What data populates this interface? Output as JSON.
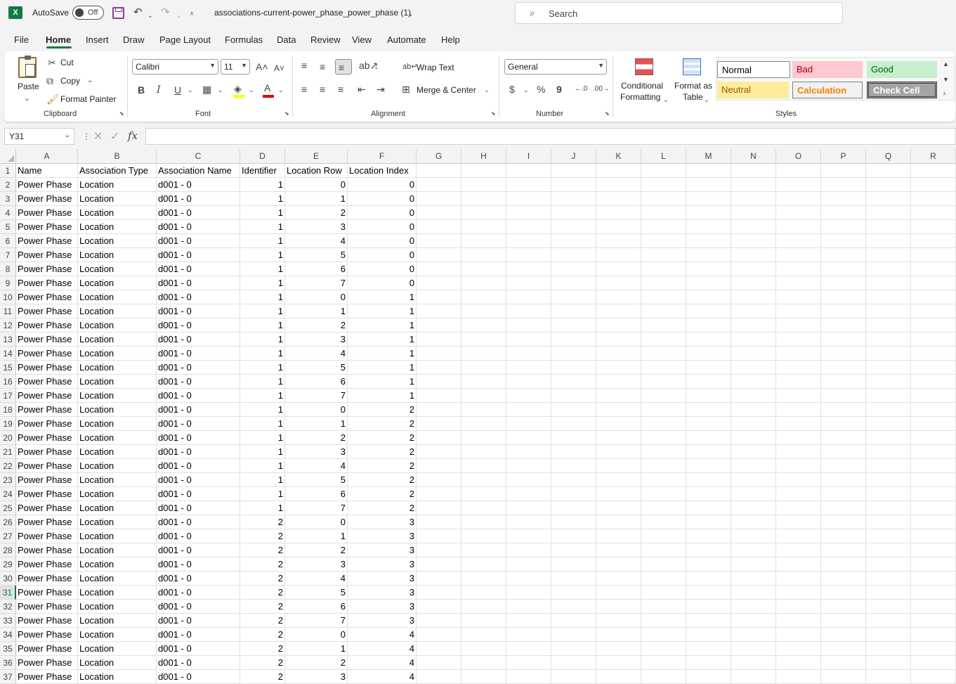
{
  "titlebar": {
    "app_icon": "X",
    "autosave_label": "AutoSave",
    "autosave_state": "Off",
    "filename": "associations-current-power_phase_power_phase (1)",
    "search_placeholder": "Search"
  },
  "menu": {
    "tabs": [
      "File",
      "Home",
      "Insert",
      "Draw",
      "Page Layout",
      "Formulas",
      "Data",
      "Review",
      "View",
      "Automate",
      "Help"
    ],
    "active_tab": "Home"
  },
  "ribbon": {
    "clipboard": {
      "paste": "Paste",
      "cut": "Cut",
      "copy": "Copy",
      "format_painter": "Format Painter",
      "label": "Clipboard"
    },
    "font": {
      "name": "Calibri",
      "size": "11",
      "bold": "B",
      "italic": "I",
      "underline": "U",
      "font_color_glyph": "A",
      "label": "Font"
    },
    "alignment": {
      "wrap_text": "Wrap Text",
      "merge_center": "Merge & Center",
      "label": "Alignment"
    },
    "number": {
      "format": "General",
      "currency": "$",
      "percent": "%",
      "comma": "9",
      "label": "Number"
    },
    "styles": {
      "conditional_1": "Conditional",
      "conditional_2": "Formatting",
      "format_table_1": "Format as",
      "format_table_2": "Table",
      "normal": "Normal",
      "bad": "Bad",
      "good": "Good",
      "neutral": "Neutral",
      "calculation": "Calculation",
      "check_cell": "Check Cell",
      "label": "Styles"
    }
  },
  "formula_bar": {
    "name_box": "Y31",
    "fx": "fx",
    "formula": ""
  },
  "sheet": {
    "columns": [
      "A",
      "B",
      "C",
      "D",
      "E",
      "F",
      "G",
      "H",
      "I",
      "J",
      "K",
      "L",
      "M",
      "N",
      "O",
      "P",
      "Q",
      "R"
    ],
    "active_row": 31,
    "header_row": [
      "Name",
      "Association Type",
      "Association Name",
      "Identifier",
      "Location Row",
      "Location Index"
    ],
    "rows": [
      [
        "Power Phase",
        "Location",
        "d001 - 0",
        "1",
        "0",
        "0"
      ],
      [
        "Power Phase",
        "Location",
        "d001 - 0",
        "1",
        "1",
        "0"
      ],
      [
        "Power Phase",
        "Location",
        "d001 - 0",
        "1",
        "2",
        "0"
      ],
      [
        "Power Phase",
        "Location",
        "d001 - 0",
        "1",
        "3",
        "0"
      ],
      [
        "Power Phase",
        "Location",
        "d001 - 0",
        "1",
        "4",
        "0"
      ],
      [
        "Power Phase",
        "Location",
        "d001 - 0",
        "1",
        "5",
        "0"
      ],
      [
        "Power Phase",
        "Location",
        "d001 - 0",
        "1",
        "6",
        "0"
      ],
      [
        "Power Phase",
        "Location",
        "d001 - 0",
        "1",
        "7",
        "0"
      ],
      [
        "Power Phase",
        "Location",
        "d001 - 0",
        "1",
        "0",
        "1"
      ],
      [
        "Power Phase",
        "Location",
        "d001 - 0",
        "1",
        "1",
        "1"
      ],
      [
        "Power Phase",
        "Location",
        "d001 - 0",
        "1",
        "2",
        "1"
      ],
      [
        "Power Phase",
        "Location",
        "d001 - 0",
        "1",
        "3",
        "1"
      ],
      [
        "Power Phase",
        "Location",
        "d001 - 0",
        "1",
        "4",
        "1"
      ],
      [
        "Power Phase",
        "Location",
        "d001 - 0",
        "1",
        "5",
        "1"
      ],
      [
        "Power Phase",
        "Location",
        "d001 - 0",
        "1",
        "6",
        "1"
      ],
      [
        "Power Phase",
        "Location",
        "d001 - 0",
        "1",
        "7",
        "1"
      ],
      [
        "Power Phase",
        "Location",
        "d001 - 0",
        "1",
        "0",
        "2"
      ],
      [
        "Power Phase",
        "Location",
        "d001 - 0",
        "1",
        "1",
        "2"
      ],
      [
        "Power Phase",
        "Location",
        "d001 - 0",
        "1",
        "2",
        "2"
      ],
      [
        "Power Phase",
        "Location",
        "d001 - 0",
        "1",
        "3",
        "2"
      ],
      [
        "Power Phase",
        "Location",
        "d001 - 0",
        "1",
        "4",
        "2"
      ],
      [
        "Power Phase",
        "Location",
        "d001 - 0",
        "1",
        "5",
        "2"
      ],
      [
        "Power Phase",
        "Location",
        "d001 - 0",
        "1",
        "6",
        "2"
      ],
      [
        "Power Phase",
        "Location",
        "d001 - 0",
        "1",
        "7",
        "2"
      ],
      [
        "Power Phase",
        "Location",
        "d001 - 0",
        "2",
        "0",
        "3"
      ],
      [
        "Power Phase",
        "Location",
        "d001 - 0",
        "2",
        "1",
        "3"
      ],
      [
        "Power Phase",
        "Location",
        "d001 - 0",
        "2",
        "2",
        "3"
      ],
      [
        "Power Phase",
        "Location",
        "d001 - 0",
        "2",
        "3",
        "3"
      ],
      [
        "Power Phase",
        "Location",
        "d001 - 0",
        "2",
        "4",
        "3"
      ],
      [
        "Power Phase",
        "Location",
        "d001 - 0",
        "2",
        "5",
        "3"
      ],
      [
        "Power Phase",
        "Location",
        "d001 - 0",
        "2",
        "6",
        "3"
      ],
      [
        "Power Phase",
        "Location",
        "d001 - 0",
        "2",
        "7",
        "3"
      ],
      [
        "Power Phase",
        "Location",
        "d001 - 0",
        "2",
        "0",
        "4"
      ],
      [
        "Power Phase",
        "Location",
        "d001 - 0",
        "2",
        "1",
        "4"
      ],
      [
        "Power Phase",
        "Location",
        "d001 - 0",
        "2",
        "2",
        "4"
      ],
      [
        "Power Phase",
        "Location",
        "d001 - 0",
        "2",
        "3",
        "4"
      ]
    ]
  },
  "colors": {
    "accent": "#107c41",
    "bad_bg": "#ffc7ce",
    "bad_fg": "#9c0006",
    "good_bg": "#c6efce",
    "good_fg": "#006100",
    "neutral_bg": "#ffeb9c",
    "neutral_fg": "#9c5700",
    "calc_fg": "#fa7d00"
  }
}
